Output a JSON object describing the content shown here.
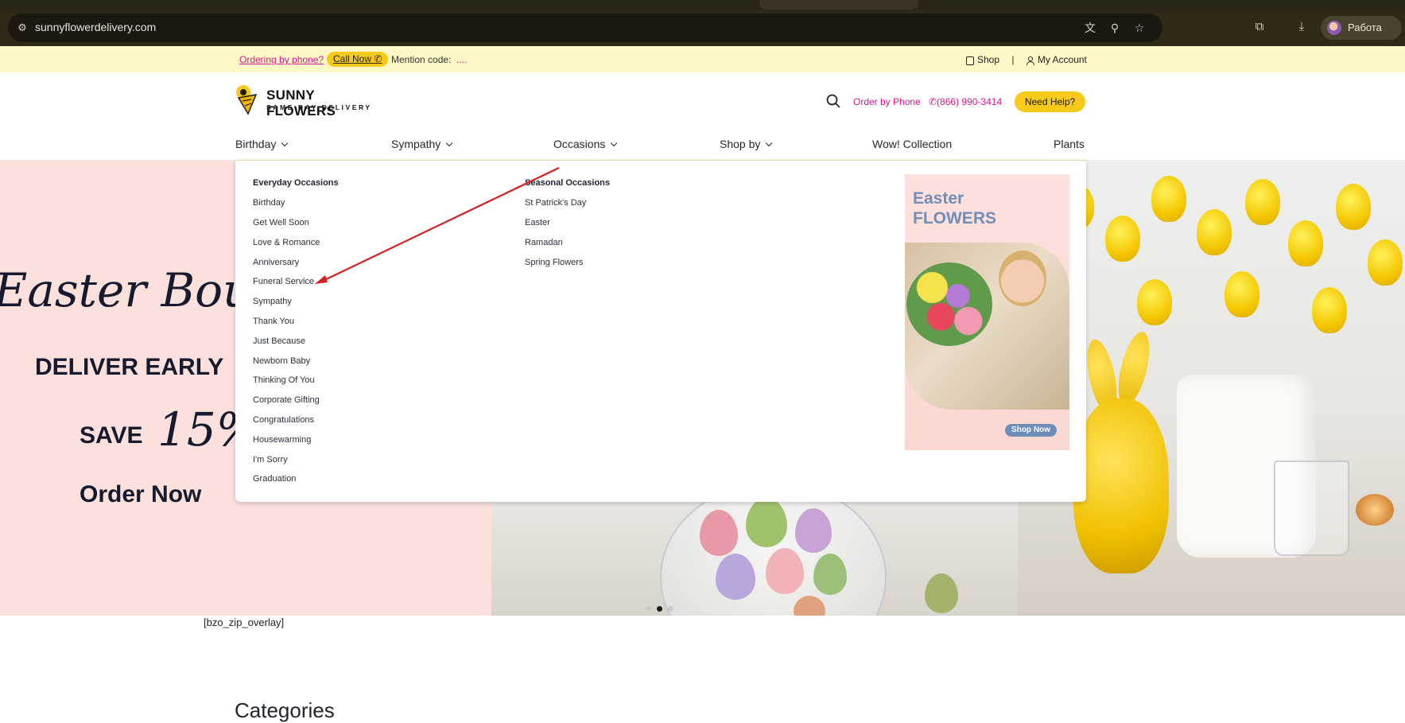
{
  "browser": {
    "url": "sunnyflowerdelivery.com",
    "profile_name": "Работа",
    "icons": [
      "site-settings-icon",
      "translate-icon",
      "zoom-icon",
      "bookmark-star-icon",
      "extensions-icon",
      "downloads-icon"
    ]
  },
  "promo_bar": {
    "ordering_by_phone": "Ordering by phone?",
    "call_now": "Call Now",
    "mention_label": "Mention code:",
    "mention_code": "....",
    "shop": "Shop",
    "separator": "|",
    "my_account": "My Account"
  },
  "header": {
    "logo_title": "SUNNY FLOWERS",
    "logo_sub": "SAME DAY DELIVERY",
    "order_by_phone": "Order by Phone",
    "phone": "(866) 990-3414",
    "need_help": "Need Help?"
  },
  "nav": {
    "items": [
      {
        "label": "Birthday",
        "dropdown": true
      },
      {
        "label": "Sympathy",
        "dropdown": true
      },
      {
        "label": "Occasions",
        "dropdown": true
      },
      {
        "label": "Shop by",
        "dropdown": true
      },
      {
        "label": "Wow! Collection",
        "dropdown": false
      },
      {
        "label": "Plants",
        "dropdown": false
      }
    ]
  },
  "mega_menu": {
    "everyday_heading": "Everyday Occasions",
    "everyday": [
      "Birthday",
      "Get Well Soon",
      "Love & Romance",
      "Anniversary",
      "Funeral Service",
      "Sympathy",
      "Thank You",
      "Just Because",
      "Newborn Baby",
      "Thinking Of You",
      "Corporate Gifting",
      "Congratulations",
      "Housewarming",
      "I'm Sorry",
      "Graduation"
    ],
    "seasonal_heading": "Seasonal Occasions",
    "seasonal": [
      "St Patrick's Day",
      "Easter",
      "Ramadan",
      "Spring Flowers"
    ],
    "promo_title": "Easter\nFLOWERS",
    "promo_button": "Shop Now"
  },
  "hero": {
    "script_text": "Easter Bouqu",
    "deliver_early": "DELIVER EARLY",
    "save": "SAVE",
    "save_pct": "15%",
    "order_now": "Order Now",
    "slides_total": 3,
    "active_slide": 2
  },
  "shortcode_text": "[bzo_zip_overlay]",
  "categories_title": "Categories",
  "colors": {
    "brand_yellow": "#f7c91a",
    "brand_pink": "#d4178b",
    "promo_bar_bg": "#fdf8c6",
    "annotation_arrow": "#d41f1f"
  }
}
